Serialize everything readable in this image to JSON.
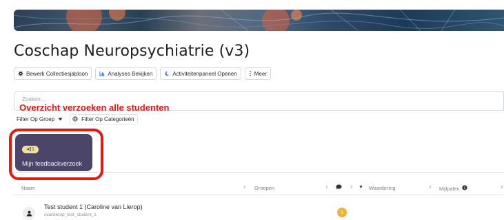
{
  "page": {
    "title": "Coschap Neuropsychiatrie (v3)"
  },
  "actions": [
    {
      "label": "Bewerk Collectiesjabloon",
      "icon": "gear-icon"
    },
    {
      "label": "Analyses Bekijken",
      "icon": "bar-chart-icon"
    },
    {
      "label": "Activiteitenpaneel Openen",
      "icon": "moon-icon"
    },
    {
      "label": "Meer",
      "icon": "kebab-icon"
    }
  ],
  "search": {
    "placeholder": "Zoeken..."
  },
  "annotation": {
    "text": "Overzicht verzoeken alle studenten",
    "color": "#e3150f"
  },
  "filters": {
    "group_label": "Filter Op Groep",
    "category_label": "Filter Op Categorieën"
  },
  "feedback_card": {
    "count": "1",
    "label": "Mijn feedbackverzoek",
    "color": "#4b4669",
    "badge_color": "#f2e29a"
  },
  "table": {
    "columns": [
      "Naam",
      "Groepen",
      "Waardering",
      "Mijlpalen"
    ],
    "rows": [
      {
        "name": "Test student 1 (Caroline van Lierop)",
        "username": "cvanlierop_test_student_1",
        "comment_count": "1"
      }
    ]
  }
}
